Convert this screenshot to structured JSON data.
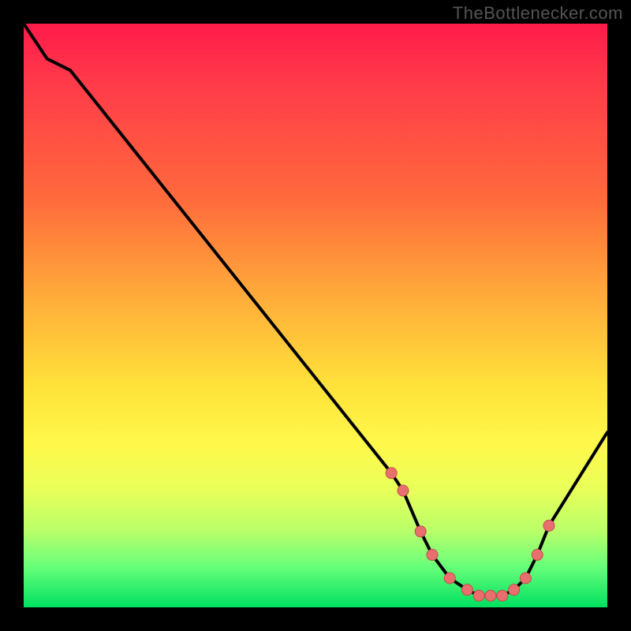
{
  "watermark": "TheBottlenecker.com",
  "colors": {
    "curve": "#000000",
    "marker_fill": "#e96f6f",
    "marker_stroke": "#c24d4d",
    "bg_top": "#ff1a4a",
    "bg_bottom": "#00e060"
  },
  "chart_data": {
    "type": "line",
    "title": "",
    "xlabel": "",
    "ylabel": "",
    "xlim": [
      0,
      100
    ],
    "ylim": [
      0,
      100
    ],
    "series": [
      {
        "name": "curve",
        "x": [
          0,
          4,
          8,
          63,
          65,
          68,
          70,
          73,
          76,
          78,
          80,
          82,
          84,
          86,
          88,
          90,
          100
        ],
        "y": [
          100,
          94,
          92,
          23,
          20,
          13,
          9,
          5,
          3,
          2,
          2,
          2,
          3,
          5,
          9,
          14,
          30
        ]
      }
    ],
    "markers": {
      "x": [
        63,
        65,
        68,
        70,
        73,
        76,
        78,
        80,
        82,
        84,
        86,
        88,
        90
      ],
      "y": [
        23,
        20,
        13,
        9,
        5,
        3,
        2,
        2,
        2,
        3,
        5,
        9,
        14
      ]
    }
  }
}
